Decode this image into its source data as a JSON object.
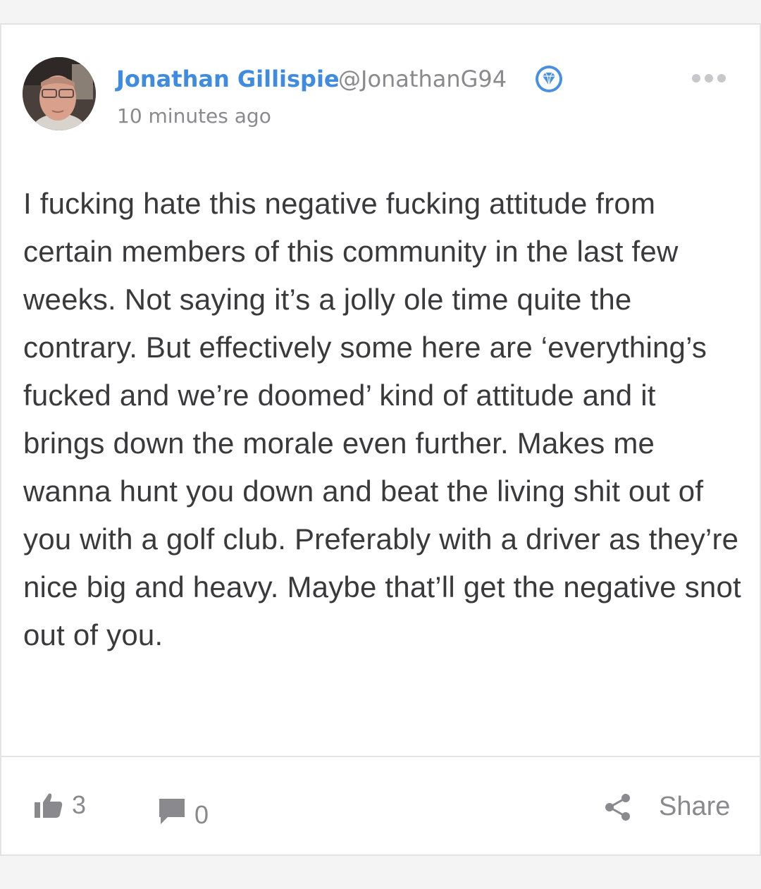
{
  "post": {
    "author_name": "Jonathan Gillispie",
    "author_handle": "@JonathanG94",
    "badge_icon": "diamond-badge-icon",
    "timestamp": "10 minutes ago",
    "more_icon": "more-options-icon",
    "body": "I fucking hate this negative fucking attitude from certain members of this community in the last few weeks. Not saying it’s a jolly ole time quite the contrary. But effectively some here are ‘everything’s fucked and we’re doomed’ kind of attitude and it brings down the morale even further. Makes me wanna hunt you down and beat the living shit out of you with a golf club. Preferably with a driver as they’re nice big and heavy. Maybe that’ll get the negative snot out of you."
  },
  "actions": {
    "like_icon": "thumbs-up-icon",
    "like_count": "3",
    "comment_icon": "comment-icon",
    "comment_count": "0",
    "share_icon": "share-icon",
    "share_label": "Share"
  },
  "colors": {
    "author": "#3f8be0",
    "muted": "#8a8a8e",
    "text": "#3a3a3c",
    "badge": "#4a90e2"
  }
}
